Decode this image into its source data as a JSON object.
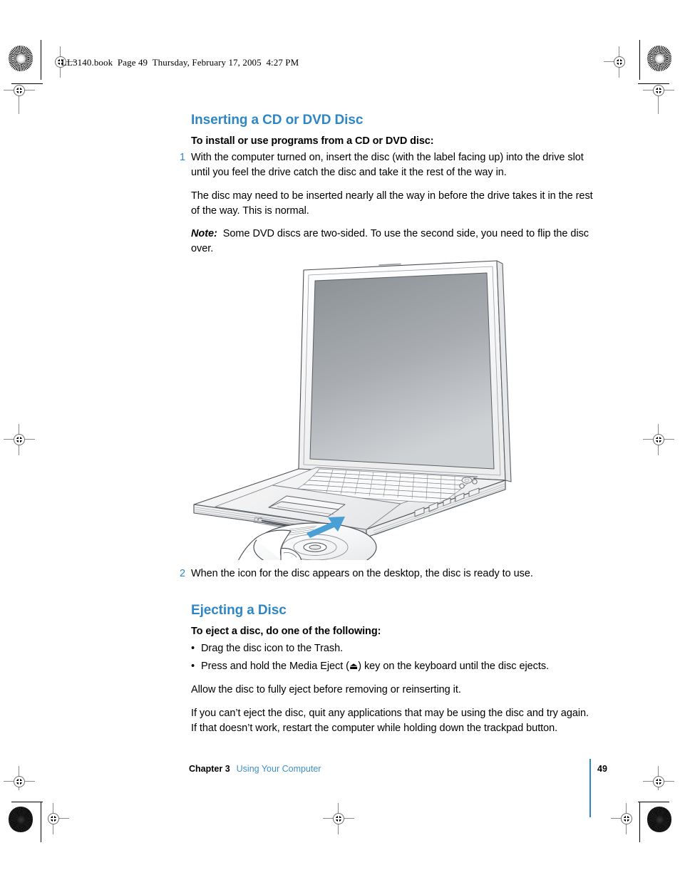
{
  "document": {
    "book_header": "LL3140.book  Page 49  Thursday, February 17, 2005  4:27 PM",
    "accent_color": "#2f86c5",
    "link_color": "#3e8fcc"
  },
  "sections": [
    {
      "title": "Inserting a CD or DVD Disc",
      "lead": "To install or use programs from a CD or DVD disc:",
      "steps": [
        {
          "number": "1",
          "text": "With the computer turned on, insert the disc (with the label facing up) into the drive slot until you feel the drive catch the disc and take it the rest of the way in."
        },
        {
          "number": "2",
          "text": "When the icon for the disc appears on the desktop, the disc is ready to use."
        }
      ],
      "paragraphs": [
        "The disc may need to be inserted nearly all the way in before the drive takes it in the rest of the way. This is normal."
      ],
      "note": {
        "label": "Note:",
        "text": "Some DVD discs are two-sided. To use the second side, you need to flip the disc over."
      }
    },
    {
      "title": "Ejecting a Disc",
      "lead": "To eject a disc, do one of the following:",
      "bullets": [
        {
          "mark": "•",
          "text": "Drag the disc icon to the Trash."
        },
        {
          "mark": "•",
          "text_before": "Press and hold the Media Eject (",
          "glyph": "⏏",
          "text_after": ") key on the keyboard until the disc ejects."
        }
      ],
      "paragraphs": [
        "Allow the disc to fully eject before removing or reinserting it.",
        "If you can’t eject the disc, quit any applications that may be using the disc and try again. If that doesn’t work, restart the computer while holding down the trackpad button."
      ]
    }
  ],
  "figure": {
    "caption": "Line illustration of an open notebook computer with a hand inserting a CD into the front slot-loading optical drive, with a blue arrow indicating the insertion direction.",
    "arrow_color": "#4a9fd4",
    "screen_color_top": "#8e9296",
    "screen_color_bottom": "#c8cbce"
  },
  "footer": {
    "chapter": "Chapter 3",
    "chapter_title": "Using Your Computer",
    "page_number": "49"
  }
}
